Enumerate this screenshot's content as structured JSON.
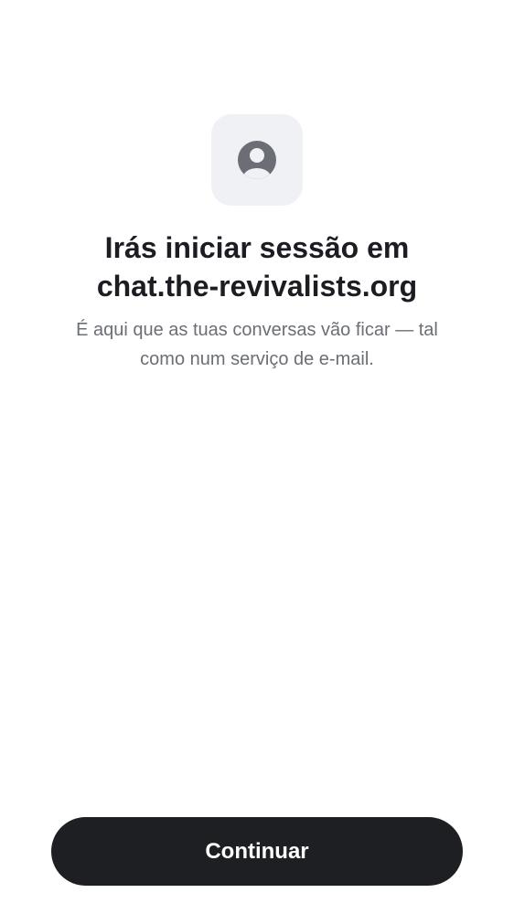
{
  "header": {
    "icon": "user-circle-icon",
    "title_line1": "Irás iniciar sessão em",
    "title_line2": "chat.the-revivalists.org",
    "subtitle_line1": "É aqui que as tuas conversas vão ficar — tal",
    "subtitle_line2": "como num serviço de e-mail."
  },
  "actions": {
    "continue_label": "Continuar"
  },
  "colors": {
    "icon_tile_bg": "#eff1f5",
    "icon": "#6b6e75",
    "title": "#1b1d22",
    "subtitle": "#6b6e75",
    "button_bg": "#1e1f23",
    "button_text": "#ffffff"
  }
}
